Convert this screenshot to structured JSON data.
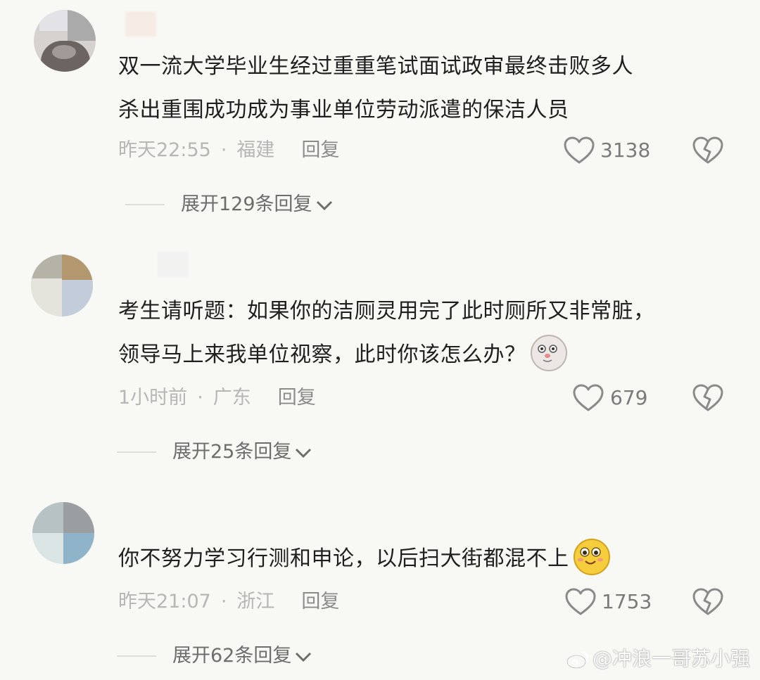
{
  "comments": [
    {
      "text_lines": [
        "双一流大学毕业生经过重重笔试面试政审最终击败多人",
        "杀出重围成功成为事业单位劳动派遣的保洁人员"
      ],
      "time": "昨天22:55",
      "location": "福建",
      "reply_label": "回复",
      "likes": "3138",
      "expand_label": "展开129条回复"
    },
    {
      "text_lines": [
        "考生请听题：如果你的洁厕灵用完了此时厕所又非常脏，",
        "领导马上来我单位视察，此时你该怎么办？"
      ],
      "time": "1小时前",
      "location": "广东",
      "reply_label": "回复",
      "likes": "679",
      "expand_label": "展开25条回复",
      "emoji": "cat-face-emoji"
    },
    {
      "text_lines": [
        "你不努力学习行测和申论，以后扫大街都混不上"
      ],
      "time": "昨天21:07",
      "location": "浙江",
      "reply_label": "回复",
      "likes": "1753",
      "expand_label": "展开62条回复",
      "emoji": "smile-face-emoji"
    }
  ],
  "separator": "·",
  "watermark": "@冲浪一哥苏小强",
  "colors": {
    "background": "#f8f8f5",
    "text": "#1f1f1f",
    "meta": "#b6b6b6",
    "reply": "#8b8b8b"
  },
  "icons": [
    "heart-outline-icon",
    "broken-heart-icon",
    "chevron-down-icon",
    "weibo-logo-icon"
  ]
}
